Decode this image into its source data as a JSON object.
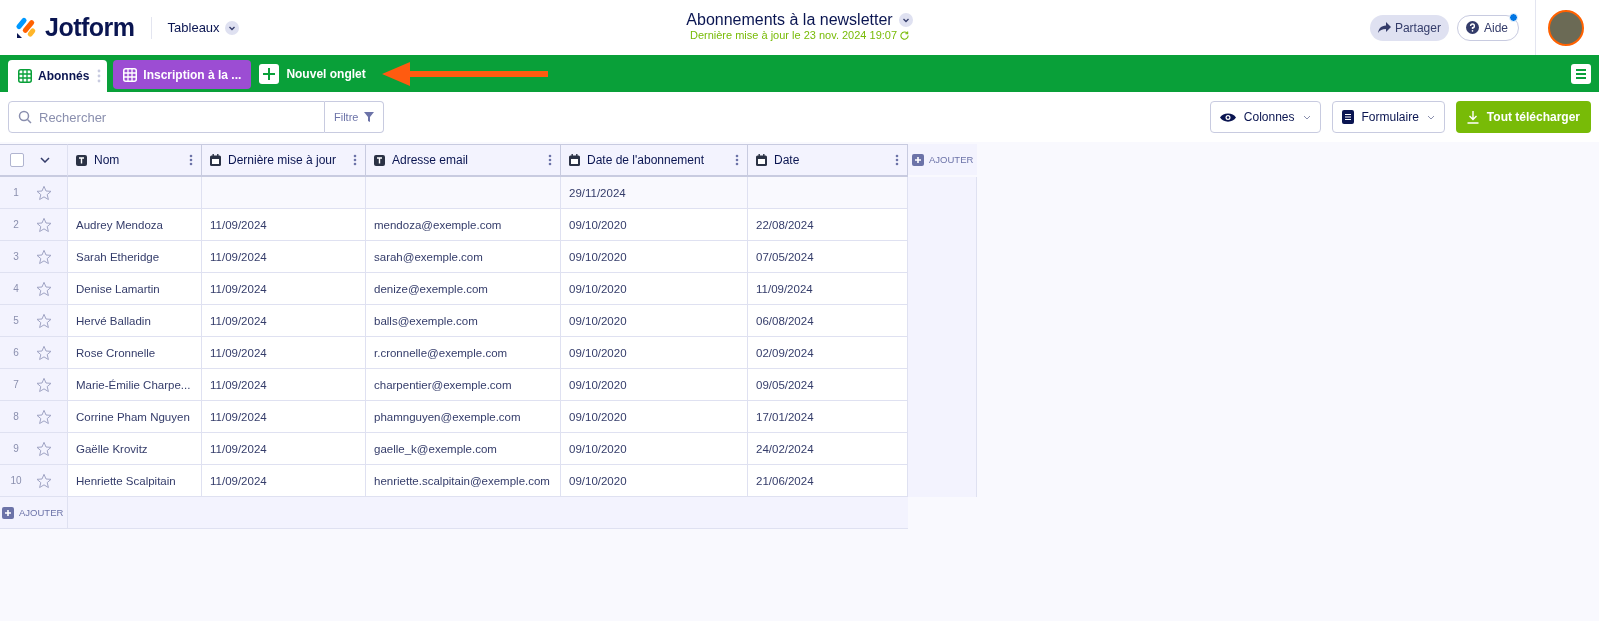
{
  "header": {
    "logo": "Jotform",
    "section": "Tableaux",
    "title": "Abonnements à la newsletter",
    "subtitle": "Dernière mise à jour le 23 nov. 2024 19:07",
    "share_button": "Partager",
    "help_button": "Aide",
    "help_notification": true
  },
  "tabs": [
    {
      "label": "Abonnés",
      "selected": true
    },
    {
      "label": "Inscription à la ...",
      "selected": false
    }
  ],
  "new_tab": "Nouvel onglet",
  "toolbar": {
    "search": {
      "placeholder": "Rechercher"
    },
    "filter": "Filtre",
    "columns_button": "Colonnes",
    "form_button": "Formulaire",
    "download_button": "Tout télécharger"
  },
  "table": {
    "select_all_checked": false,
    "columns": [
      {
        "label": "Nom",
        "kind": "text"
      },
      {
        "label": "Dernière mise à jour",
        "kind": "date"
      },
      {
        "label": "Adresse email",
        "kind": "text"
      },
      {
        "label": "Date de l'abonnement",
        "kind": "date"
      },
      {
        "label": "Date",
        "kind": "date"
      }
    ],
    "add_column": "AJOUTER",
    "rows": [
      {
        "number": "1",
        "starred": false,
        "cells": [
          "",
          "",
          "",
          "29/11/2024",
          ""
        ]
      },
      {
        "number": "2",
        "starred": false,
        "cells": [
          "Audrey Mendoza",
          "11/09/2024",
          "mendoza@exemple.com",
          "09/10/2020",
          "22/08/2024"
        ]
      },
      {
        "number": "3",
        "starred": false,
        "cells": [
          "Sarah Etheridge",
          "11/09/2024",
          "sarah@exemple.com",
          "09/10/2020",
          "07/05/2024"
        ]
      },
      {
        "number": "4",
        "starred": false,
        "cells": [
          "Denise Lamartin",
          "11/09/2024",
          "denize@exemple.com",
          "09/10/2020",
          "11/09/2024"
        ]
      },
      {
        "number": "5",
        "starred": false,
        "cells": [
          "Hervé Balladin",
          "11/09/2024",
          "balls@exemple.com",
          "09/10/2020",
          "06/08/2024"
        ]
      },
      {
        "number": "6",
        "starred": false,
        "cells": [
          "Rose Cronnelle",
          "11/09/2024",
          "r.cronnelle@exemple.com",
          "09/10/2020",
          "02/09/2024"
        ]
      },
      {
        "number": "7",
        "starred": false,
        "cells": [
          "Marie-Émilie Charpe...",
          "11/09/2024",
          "charpentier@exemple.com",
          "09/10/2020",
          "09/05/2024"
        ]
      },
      {
        "number": "8",
        "starred": false,
        "cells": [
          "Corrine Pham Nguyen",
          "11/09/2024",
          "phamnguyen@exemple.com",
          "09/10/2020",
          "17/01/2024"
        ]
      },
      {
        "number": "9",
        "starred": false,
        "cells": [
          "Gaëlle Krovitz",
          "11/09/2024",
          "gaelle_k@exemple.com",
          "09/10/2020",
          "24/02/2024"
        ]
      },
      {
        "number": "10",
        "starred": false,
        "cells": [
          "Henriette Scalpitain",
          "11/09/2024",
          "henriette.scalpitain@exemple.com",
          "09/10/2020",
          "21/06/2024"
        ]
      }
    ],
    "add_row": "AJOUTER"
  }
}
